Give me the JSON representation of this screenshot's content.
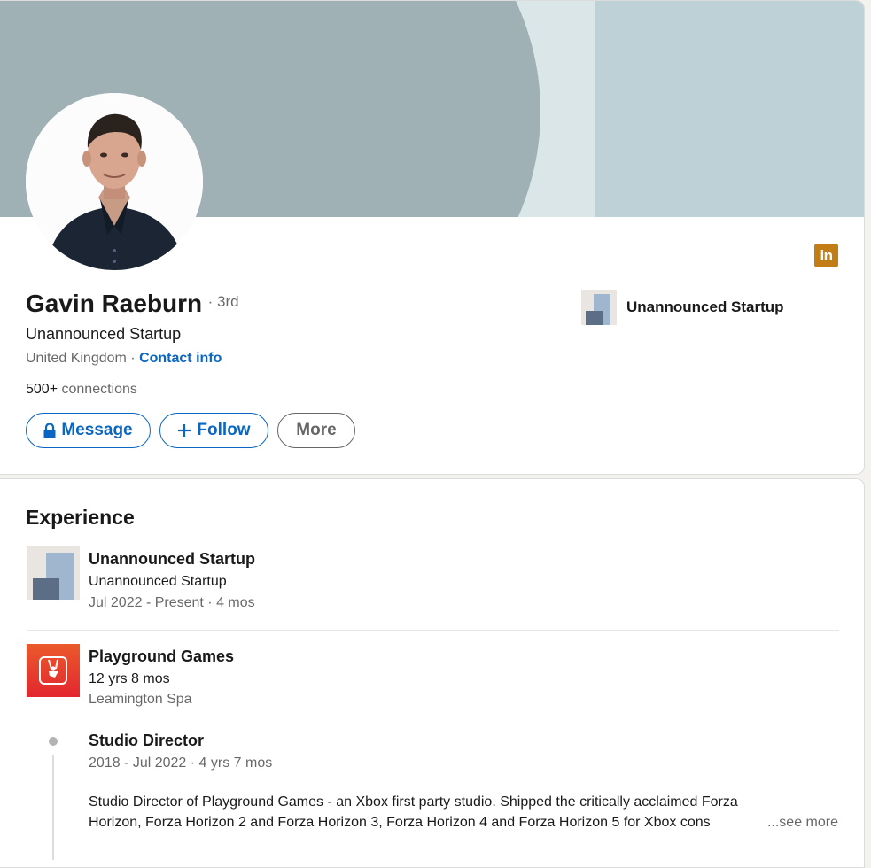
{
  "profile": {
    "name": "Gavin Raeburn",
    "degree": "· 3rd",
    "headline": "Unannounced Startup",
    "location": "United Kingdom",
    "location_sep": " · ",
    "contact_info": "Contact info",
    "connections_count": "500+",
    "connections_label": " connections",
    "current_company": "Unannounced Startup",
    "badge_icon": "linkedin-icon",
    "badge_text": "in",
    "badge_color": "#c37d16"
  },
  "actions": {
    "message_label": "Message",
    "follow_label": "Follow",
    "more_label": "More",
    "primary_color": "#0a66c2"
  },
  "experience": {
    "title": "Experience",
    "items": [
      {
        "company": "Unannounced Startup",
        "subtitle": "Unannounced Startup",
        "dates": "Jul 2022 - Present · 4 mos"
      },
      {
        "company": "Playground Games",
        "duration": "12 yrs 8 mos",
        "location": "Leamington Spa",
        "roles": [
          {
            "title": "Studio Director",
            "dates": "2018 - Jul 2022 · 4 yrs 7 mos",
            "description_line1": "Studio Director of Playground Games - an Xbox first party studio. Shipped the critically acclaimed Forza",
            "description_line2": "Horizon, Forza Horizon 2 and Forza Horizon 3, Forza Horizon 4 and Forza Horizon 5 for Xbox cons",
            "see_more": "...see more"
          }
        ]
      }
    ]
  }
}
